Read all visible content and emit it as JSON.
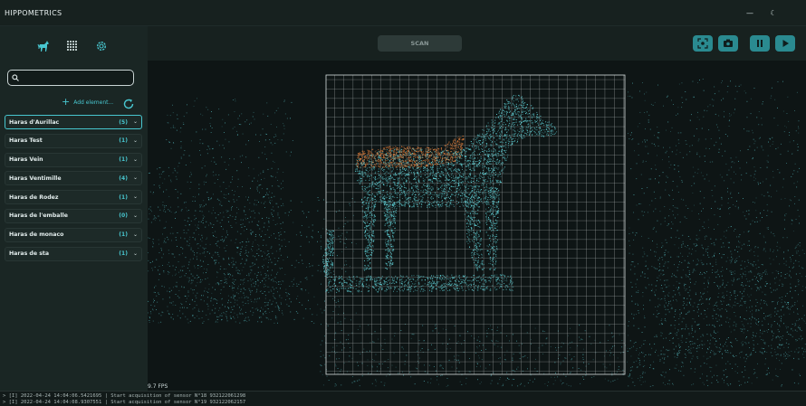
{
  "app": {
    "title": "HIPPOMETRICS"
  },
  "window_controls": {
    "minimize_glyph": "—",
    "theme_glyph": "☾"
  },
  "nav": {
    "icons": [
      "horse-icon",
      "grid-icon",
      "gear-icon"
    ],
    "active_color": "#48c6cf"
  },
  "search": {
    "value": "",
    "placeholder": ""
  },
  "add_element": {
    "label": "Add element..."
  },
  "haras_list": [
    {
      "name": "Haras  d'Aurillac",
      "count": "(5)",
      "active": true
    },
    {
      "name": "Haras Test",
      "count": "(1)"
    },
    {
      "name": "Haras Vein",
      "count": "(1)"
    },
    {
      "name": "Haras Ventimille",
      "count": "(4)"
    },
    {
      "name": "Haras de Rodez",
      "count": "(1)"
    },
    {
      "name": "Haras de l'emballe",
      "count": "(0)"
    },
    {
      "name": "Haras de monaco",
      "count": "(1)"
    },
    {
      "name": "Haras de sta",
      "count": "(1)"
    }
  ],
  "toolbar": {
    "scan_label": "SCAN",
    "buttons": [
      "focus-icon",
      "camera-icon",
      "pause-icon",
      "play-icon"
    ]
  },
  "viewport": {
    "fps": "9.7 FPS"
  },
  "console": {
    "lines": [
      "> [I] 2022-04-24 14:04:06.5421695 |  Start acquisition of sensor N°18 932122061298",
      "> [I] 2022-04-24 14:04:08.9307551 |  Start acquisition of sensor N°19 932122062157"
    ]
  },
  "colors": {
    "accent": "#48c6cf",
    "button": "#2a8a90",
    "pointcloud": "#5fd0d6",
    "saddle": "#d97a3a"
  }
}
